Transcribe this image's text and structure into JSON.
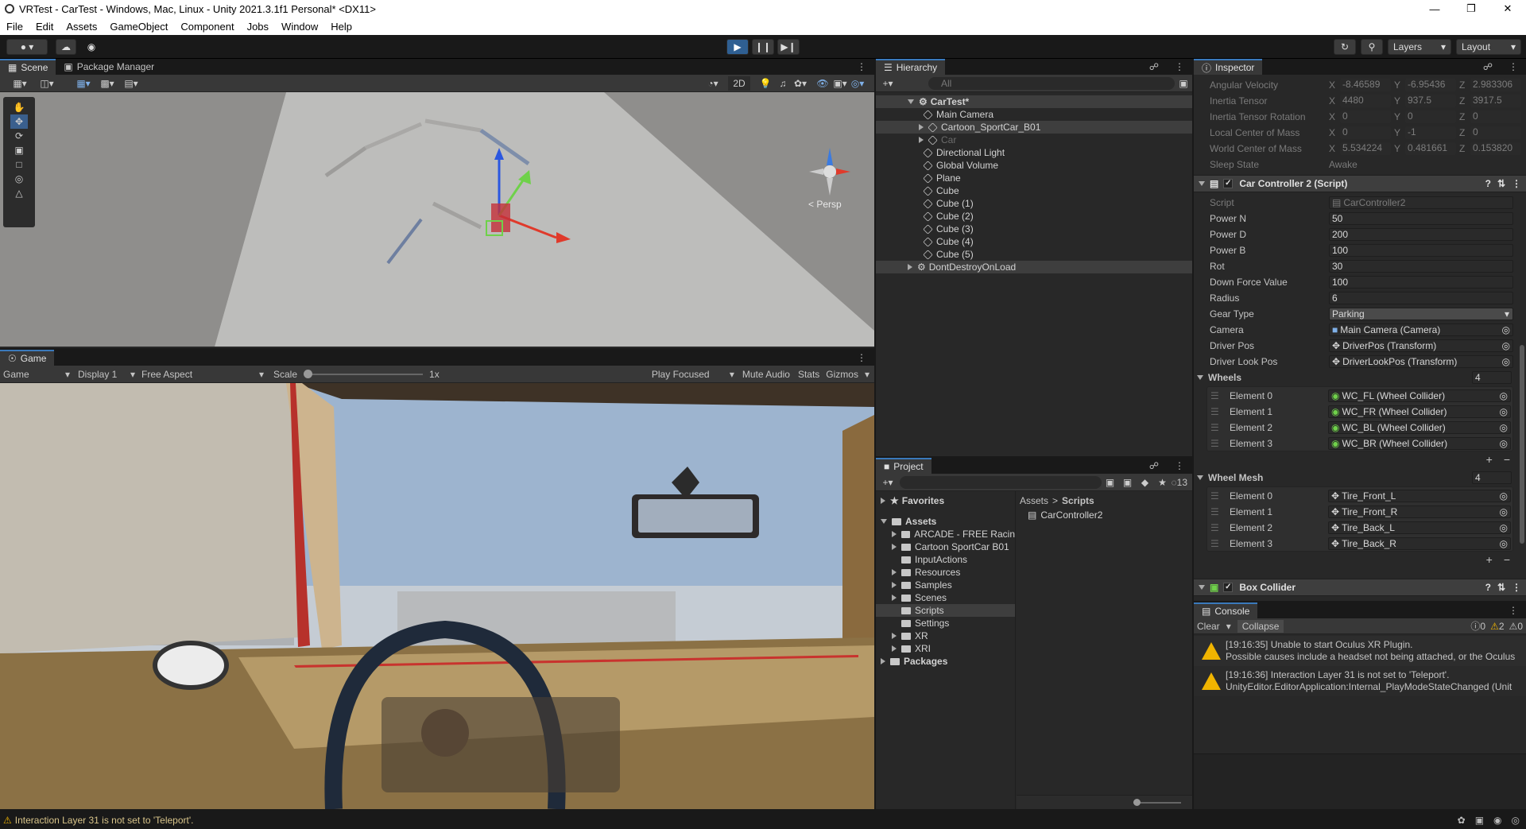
{
  "window": {
    "title": "VRTest - CarTest - Windows, Mac, Linux - Unity 2021.3.1f1 Personal* <DX11>"
  },
  "menu": [
    "File",
    "Edit",
    "Assets",
    "GameObject",
    "Component",
    "Jobs",
    "Window",
    "Help"
  ],
  "toolbar": {
    "layers_label": "Layers",
    "layout_label": "Layout"
  },
  "scene_panel": {
    "tabs": [
      "Scene",
      "Package Manager"
    ],
    "mode_2d": "2D",
    "persp_label": "< Persp"
  },
  "game_panel": {
    "tab": "Game",
    "dropdown_game": "Game",
    "display": "Display 1",
    "aspect": "Free Aspect",
    "scale_label": "Scale",
    "scale_value": "1x",
    "play_focused": "Play Focused",
    "mute": "Mute Audio",
    "stats": "Stats",
    "gizmos": "Gizmos"
  },
  "hierarchy": {
    "tab": "Hierarchy",
    "search_placeholder": "All",
    "items": [
      {
        "label": "CarTest*",
        "depth": 0
      },
      {
        "label": "Main Camera",
        "depth": 1
      },
      {
        "label": "Cartoon_SportCar_B01",
        "depth": 1
      },
      {
        "label": "Car",
        "depth": 1
      },
      {
        "label": "Directional Light",
        "depth": 1
      },
      {
        "label": "Global Volume",
        "depth": 1
      },
      {
        "label": "Plane",
        "depth": 1
      },
      {
        "label": "Cube",
        "depth": 1
      },
      {
        "label": "Cube (1)",
        "depth": 1
      },
      {
        "label": "Cube (2)",
        "depth": 1
      },
      {
        "label": "Cube (3)",
        "depth": 1
      },
      {
        "label": "Cube (4)",
        "depth": 1
      },
      {
        "label": "Cube (5)",
        "depth": 1
      },
      {
        "label": "DontDestroyOnLoad",
        "depth": 0
      }
    ]
  },
  "project": {
    "tab": "Project",
    "badge": "13",
    "favorites": "Favorites",
    "assets": "Assets",
    "folders": [
      "ARCADE - FREE Racin",
      "Cartoon SportCar B01",
      "InputActions",
      "Resources",
      "Samples",
      "Scenes",
      "Scripts",
      "Settings",
      "XR",
      "XRI"
    ],
    "packages": "Packages",
    "breadcrumb_root": "Assets",
    "breadcrumb_sep": ">",
    "breadcrumb_current": "Scripts",
    "files": [
      "CarController2"
    ]
  },
  "inspector": {
    "tab": "Inspector",
    "rigidbody_rows": [
      {
        "label": "Angular Velocity",
        "x": "-8.46589",
        "y": "-6.95436",
        "z": "2.983306"
      },
      {
        "label": "Inertia Tensor",
        "x": "4480",
        "y": "937.5",
        "z": "3917.5"
      },
      {
        "label": "Inertia Tensor Rotation",
        "x": "0",
        "y": "0",
        "z": "0"
      },
      {
        "label": "Local Center of Mass",
        "x": "0",
        "y": "-1",
        "z": "0"
      },
      {
        "label": "World Center of Mass",
        "x": "5.534224",
        "y": "0.481661",
        "z": "0.153820"
      }
    ],
    "sleep_label": "Sleep State",
    "sleep_value": "Awake",
    "component_title": "Car Controller 2 (Script)",
    "fields": [
      {
        "label": "Script",
        "value": "CarController2"
      },
      {
        "label": "Power N",
        "value": "50"
      },
      {
        "label": "Power D",
        "value": "200"
      },
      {
        "label": "Power B",
        "value": "100"
      },
      {
        "label": "Rot",
        "value": "30"
      },
      {
        "label": "Down Force Value",
        "value": "100"
      },
      {
        "label": "Radius",
        "value": "6"
      },
      {
        "label": "Gear Type",
        "value": "Parking"
      },
      {
        "label": "Camera",
        "value": "Main Camera (Camera)"
      },
      {
        "label": "Driver Pos",
        "value": "DriverPos (Transform)"
      },
      {
        "label": "Driver Look Pos",
        "value": "DriverLookPos (Transform)"
      }
    ],
    "wheels_label": "Wheels",
    "wheels_count": "4",
    "wheels": [
      {
        "label": "Element 0",
        "value": "WC_FL (Wheel Collider)"
      },
      {
        "label": "Element 1",
        "value": "WC_FR (Wheel Collider)"
      },
      {
        "label": "Element 2",
        "value": "WC_BL (Wheel Collider)"
      },
      {
        "label": "Element 3",
        "value": "WC_BR (Wheel Collider)"
      }
    ],
    "mesh_label": "Wheel Mesh",
    "mesh_count": "4",
    "meshes": [
      {
        "label": "Element 0",
        "value": "Tire_Front_L"
      },
      {
        "label": "Element 1",
        "value": "Tire_Front_R"
      },
      {
        "label": "Element 2",
        "value": "Tire_Back_L"
      },
      {
        "label": "Element 3",
        "value": "Tire_Back_R"
      }
    ],
    "box_collider": "Box Collider"
  },
  "console": {
    "tab": "Console",
    "clear": "Clear",
    "collapse": "Collapse",
    "count_info": "0",
    "count_warn": "2",
    "count_err": "0",
    "messages": [
      {
        "line1": "[19:16:35] Unable to start Oculus XR Plugin.",
        "line2": "Possible causes include a headset not being attached, or the Oculus"
      },
      {
        "line1": "[19:16:36] Interaction Layer 31 is not set to 'Teleport'.",
        "line2": "UnityEditor.EditorApplication:Internal_PlayModeStateChanged (Unit"
      }
    ]
  },
  "statusbar": {
    "message": "Interaction Layer 31 is not set to 'Teleport'."
  }
}
